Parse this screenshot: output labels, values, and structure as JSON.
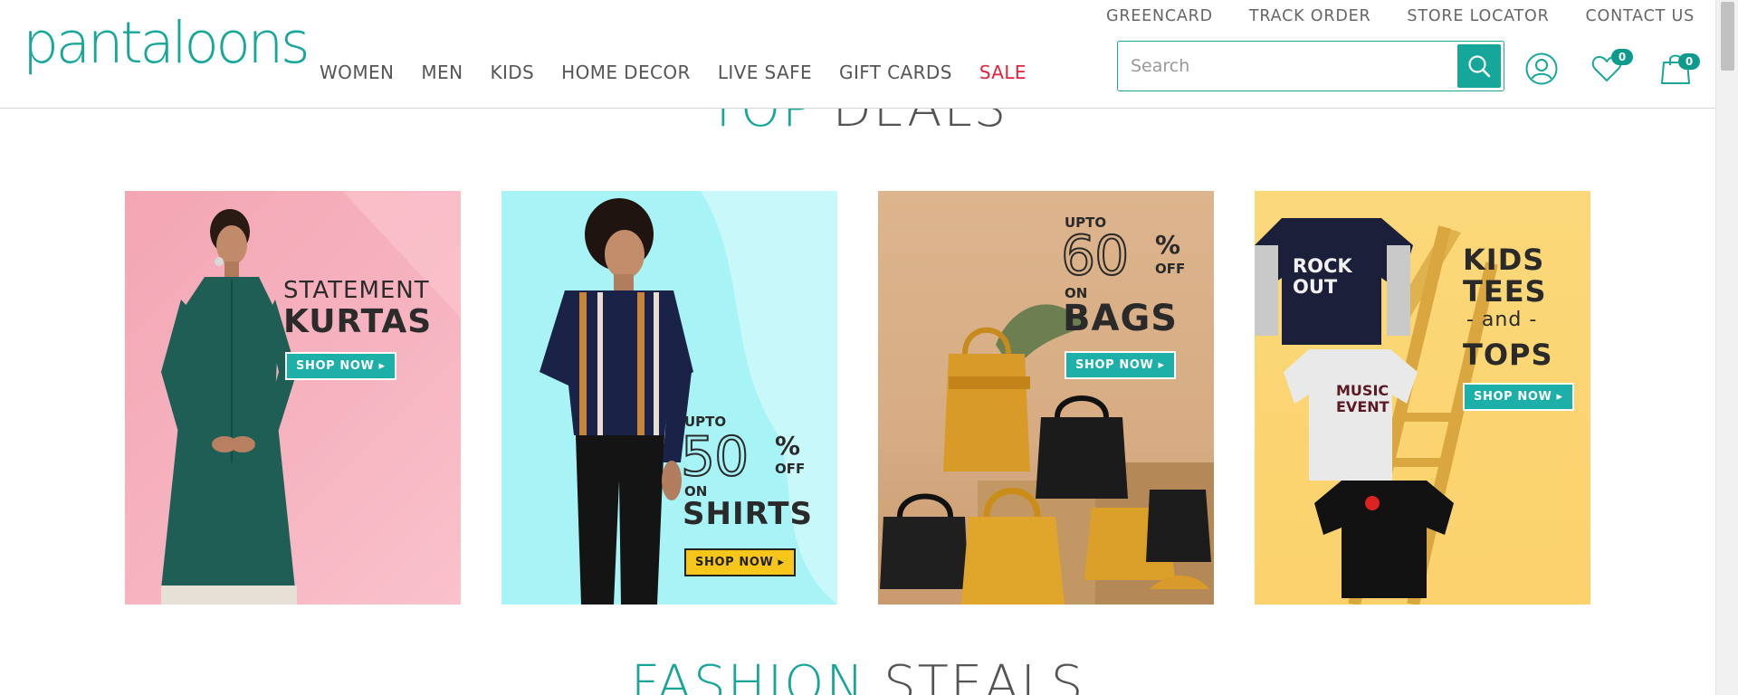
{
  "logo": "pantaloons",
  "utility_links": [
    "GREENCARD",
    "TRACK ORDER",
    "STORE LOCATOR",
    "CONTACT US"
  ],
  "nav": [
    "WOMEN",
    "MEN",
    "KIDS",
    "HOME DECOR",
    "LIVE SAFE",
    "GIFT CARDS",
    "SALE"
  ],
  "search": {
    "placeholder": "Search"
  },
  "icons": {
    "search": "search-icon",
    "user": "user-icon",
    "wishlist": "heart-icon",
    "bag": "shopping-bag-icon"
  },
  "wishlist_count": "0",
  "bag_count": "0",
  "top_deals": {
    "accent": "TOP",
    "rest": "DEALS"
  },
  "fashion_steals": {
    "accent": "FASHION",
    "rest": "STEALS"
  },
  "colors": {
    "brand": "#16a79a",
    "sale": "#e2233b",
    "text": "#555555"
  },
  "deals": [
    {
      "line1": "STATEMENT",
      "line2": "KURTAS",
      "cta": "SHOP NOW ▸"
    },
    {
      "upto": "UPTO",
      "percent": "50",
      "pct_sign": "%",
      "off": "OFF",
      "on": "ON",
      "category": "SHIRTS",
      "cta": "SHOP NOW ▸"
    },
    {
      "upto": "UPTO",
      "percent": "60",
      "pct_sign": "%",
      "off": "OFF",
      "on": "ON",
      "category": "BAGS",
      "cta": "SHOP NOW ▸"
    },
    {
      "line1": "KIDS",
      "line2": "TEES",
      "line3": "- and -",
      "line4": "TOPS",
      "cta": "SHOP NOW ▸",
      "tee1": "ROCK OUT",
      "tee2": "MUSIC EVENT"
    }
  ]
}
